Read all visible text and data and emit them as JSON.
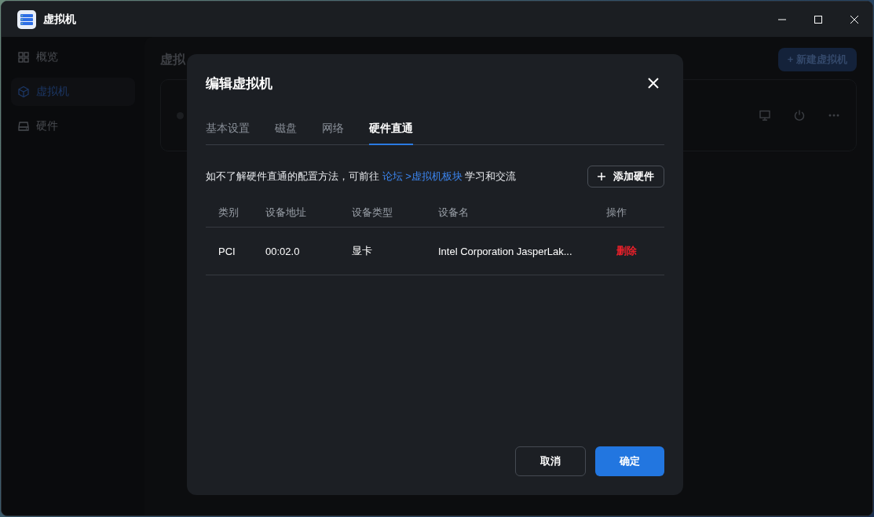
{
  "window": {
    "title": "虚拟机"
  },
  "sidebar": {
    "items": [
      {
        "label": "概览",
        "kind": "grid",
        "selected": false
      },
      {
        "label": "虚拟机",
        "kind": "cube",
        "selected": true
      },
      {
        "label": "硬件",
        "kind": "drive",
        "selected": false
      }
    ]
  },
  "main": {
    "title": "虚拟",
    "new_button": "+ 新建虚拟机"
  },
  "dialog": {
    "title": "编辑虚拟机",
    "tabs": [
      {
        "label": "基本设置",
        "selected": false
      },
      {
        "label": "磁盘",
        "selected": false
      },
      {
        "label": "网络",
        "selected": false
      },
      {
        "label": "硬件直通",
        "selected": true
      }
    ],
    "notice": {
      "before": "如不了解硬件直通的配置方法，可前往",
      "link": "论坛 >虚拟机板块",
      "after": "学习和交流"
    },
    "add_button": "添加硬件",
    "table": {
      "columns": [
        "类别",
        "设备地址",
        "设备类型",
        "设备名",
        "操作"
      ],
      "rows": [
        {
          "cells": [
            "PCI",
            "00:02.0",
            "显卡",
            "Intel Corporation JasperLak..."
          ],
          "action": "删除"
        }
      ]
    },
    "cancel_button": "取消",
    "confirm_button": "确定"
  }
}
